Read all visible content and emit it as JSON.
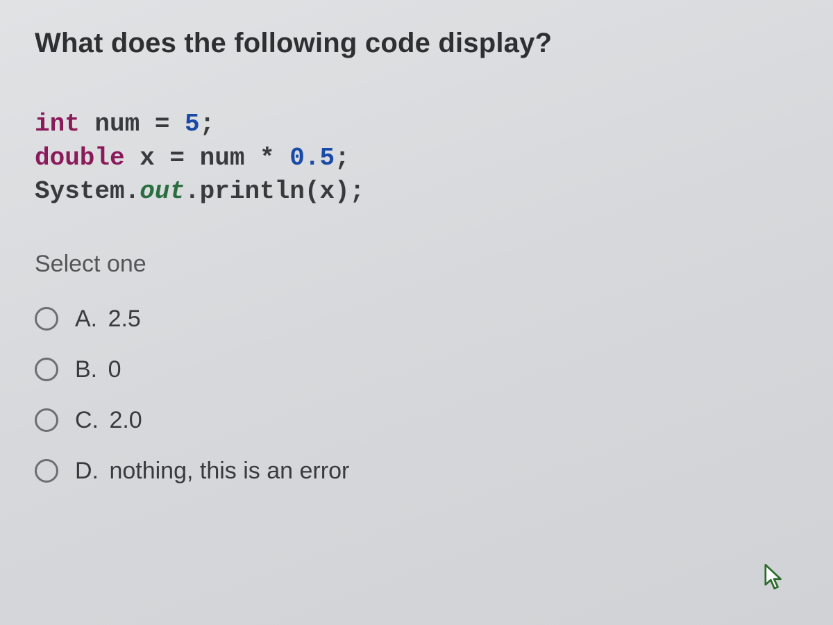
{
  "question": "What does the following code display?",
  "code": {
    "l1_kw": "int",
    "l1_rest": " num = ",
    "l1_lit": "5",
    "l1_semi": ";",
    "l2_kw": "double",
    "l2_rest": " x = num * ",
    "l2_lit": "0.5",
    "l2_semi": ";",
    "l3_sys": "System.",
    "l3_out": "out",
    "l3_print": ".println(x);"
  },
  "select_label": "Select one",
  "options": [
    {
      "letter": "A.",
      "text": "2.5"
    },
    {
      "letter": "B.",
      "text": "0"
    },
    {
      "letter": "C.",
      "text": "2.0"
    },
    {
      "letter": "D.",
      "text": "nothing, this is an error"
    }
  ]
}
